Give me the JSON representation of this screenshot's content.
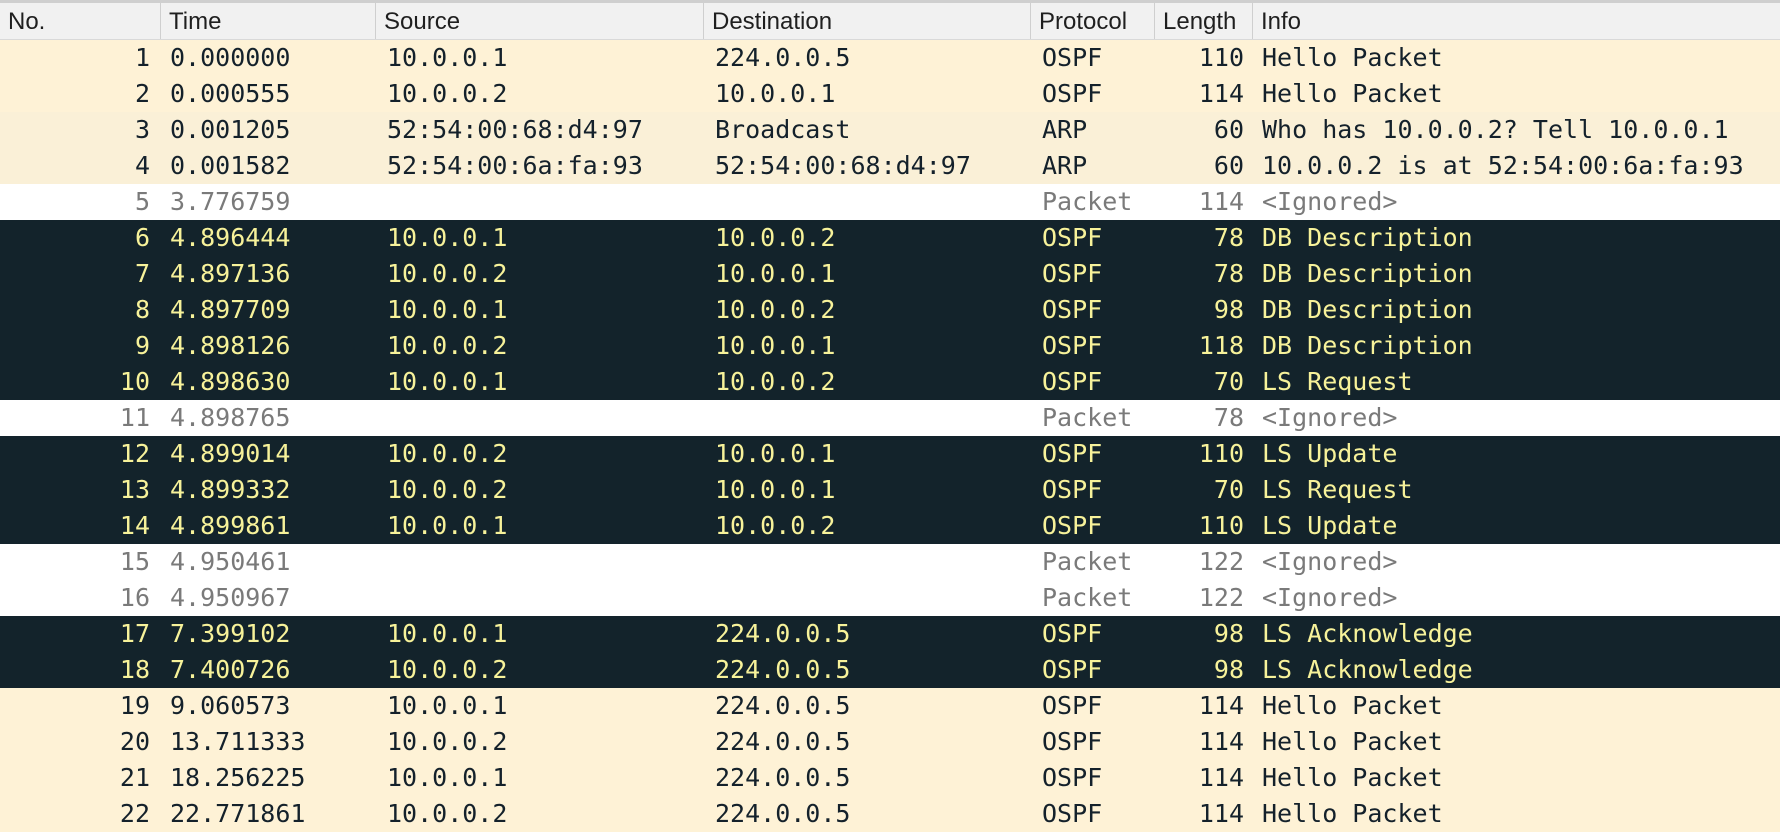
{
  "columns": {
    "no": "No.",
    "time": "Time",
    "source": "Source",
    "destination": "Destination",
    "protocol": "Protocol",
    "length": "Length",
    "info": "Info"
  },
  "colors": {
    "ospf_bg": "#fef2d6",
    "arp_bg": "#faf0d7",
    "ignored_bg": "#ffffff",
    "marked_bg": "#13232b",
    "marked_fg": "#f7f29a"
  },
  "rows": [
    {
      "no": "1",
      "time": "0.000000",
      "source": "10.0.0.1",
      "destination": "224.0.0.5",
      "protocol": "OSPF",
      "length": "110",
      "info": "Hello Packet",
      "style": "ospf"
    },
    {
      "no": "2",
      "time": "0.000555",
      "source": "10.0.0.2",
      "destination": "10.0.0.1",
      "protocol": "OSPF",
      "length": "114",
      "info": "Hello Packet",
      "style": "ospf"
    },
    {
      "no": "3",
      "time": "0.001205",
      "source": "52:54:00:68:d4:97",
      "destination": "Broadcast",
      "protocol": "ARP",
      "length": "60",
      "info": "Who has 10.0.0.2? Tell 10.0.0.1",
      "style": "arp"
    },
    {
      "no": "4",
      "time": "0.001582",
      "source": "52:54:00:6a:fa:93",
      "destination": "52:54:00:68:d4:97",
      "protocol": "ARP",
      "length": "60",
      "info": "10.0.0.2 is at 52:54:00:6a:fa:93",
      "style": "arp"
    },
    {
      "no": "5",
      "time": "3.776759",
      "source": "",
      "destination": "",
      "protocol": "Packet",
      "length": "114",
      "info": "<Ignored>",
      "style": "ignored"
    },
    {
      "no": "6",
      "time": "4.896444",
      "source": "10.0.0.1",
      "destination": "10.0.0.2",
      "protocol": "OSPF",
      "length": "78",
      "info": "DB Description",
      "style": "marked"
    },
    {
      "no": "7",
      "time": "4.897136",
      "source": "10.0.0.2",
      "destination": "10.0.0.1",
      "protocol": "OSPF",
      "length": "78",
      "info": "DB Description",
      "style": "marked"
    },
    {
      "no": "8",
      "time": "4.897709",
      "source": "10.0.0.1",
      "destination": "10.0.0.2",
      "protocol": "OSPF",
      "length": "98",
      "info": "DB Description",
      "style": "marked"
    },
    {
      "no": "9",
      "time": "4.898126",
      "source": "10.0.0.2",
      "destination": "10.0.0.1",
      "protocol": "OSPF",
      "length": "118",
      "info": "DB Description",
      "style": "marked"
    },
    {
      "no": "10",
      "time": "4.898630",
      "source": "10.0.0.1",
      "destination": "10.0.0.2",
      "protocol": "OSPF",
      "length": "70",
      "info": "LS Request",
      "style": "marked"
    },
    {
      "no": "11",
      "time": "4.898765",
      "source": "",
      "destination": "",
      "protocol": "Packet",
      "length": "78",
      "info": "<Ignored>",
      "style": "ignored"
    },
    {
      "no": "12",
      "time": "4.899014",
      "source": "10.0.0.2",
      "destination": "10.0.0.1",
      "protocol": "OSPF",
      "length": "110",
      "info": "LS Update",
      "style": "marked"
    },
    {
      "no": "13",
      "time": "4.899332",
      "source": "10.0.0.2",
      "destination": "10.0.0.1",
      "protocol": "OSPF",
      "length": "70",
      "info": "LS Request",
      "style": "marked"
    },
    {
      "no": "14",
      "time": "4.899861",
      "source": "10.0.0.1",
      "destination": "10.0.0.2",
      "protocol": "OSPF",
      "length": "110",
      "info": "LS Update",
      "style": "marked"
    },
    {
      "no": "15",
      "time": "4.950461",
      "source": "",
      "destination": "",
      "protocol": "Packet",
      "length": "122",
      "info": "<Ignored>",
      "style": "ignored"
    },
    {
      "no": "16",
      "time": "4.950967",
      "source": "",
      "destination": "",
      "protocol": "Packet",
      "length": "122",
      "info": "<Ignored>",
      "style": "ignored"
    },
    {
      "no": "17",
      "time": "7.399102",
      "source": "10.0.0.1",
      "destination": "224.0.0.5",
      "protocol": "OSPF",
      "length": "98",
      "info": "LS Acknowledge",
      "style": "marked"
    },
    {
      "no": "18",
      "time": "7.400726",
      "source": "10.0.0.2",
      "destination": "224.0.0.5",
      "protocol": "OSPF",
      "length": "98",
      "info": "LS Acknowledge",
      "style": "marked"
    },
    {
      "no": "19",
      "time": "9.060573",
      "source": "10.0.0.1",
      "destination": "224.0.0.5",
      "protocol": "OSPF",
      "length": "114",
      "info": "Hello Packet",
      "style": "ospf"
    },
    {
      "no": "20",
      "time": "13.711333",
      "source": "10.0.0.2",
      "destination": "224.0.0.5",
      "protocol": "OSPF",
      "length": "114",
      "info": "Hello Packet",
      "style": "ospf"
    },
    {
      "no": "21",
      "time": "18.256225",
      "source": "10.0.0.1",
      "destination": "224.0.0.5",
      "protocol": "OSPF",
      "length": "114",
      "info": "Hello Packet",
      "style": "ospf"
    },
    {
      "no": "22",
      "time": "22.771861",
      "source": "10.0.0.2",
      "destination": "224.0.0.5",
      "protocol": "OSPF",
      "length": "114",
      "info": "Hello Packet",
      "style": "ospf"
    }
  ]
}
